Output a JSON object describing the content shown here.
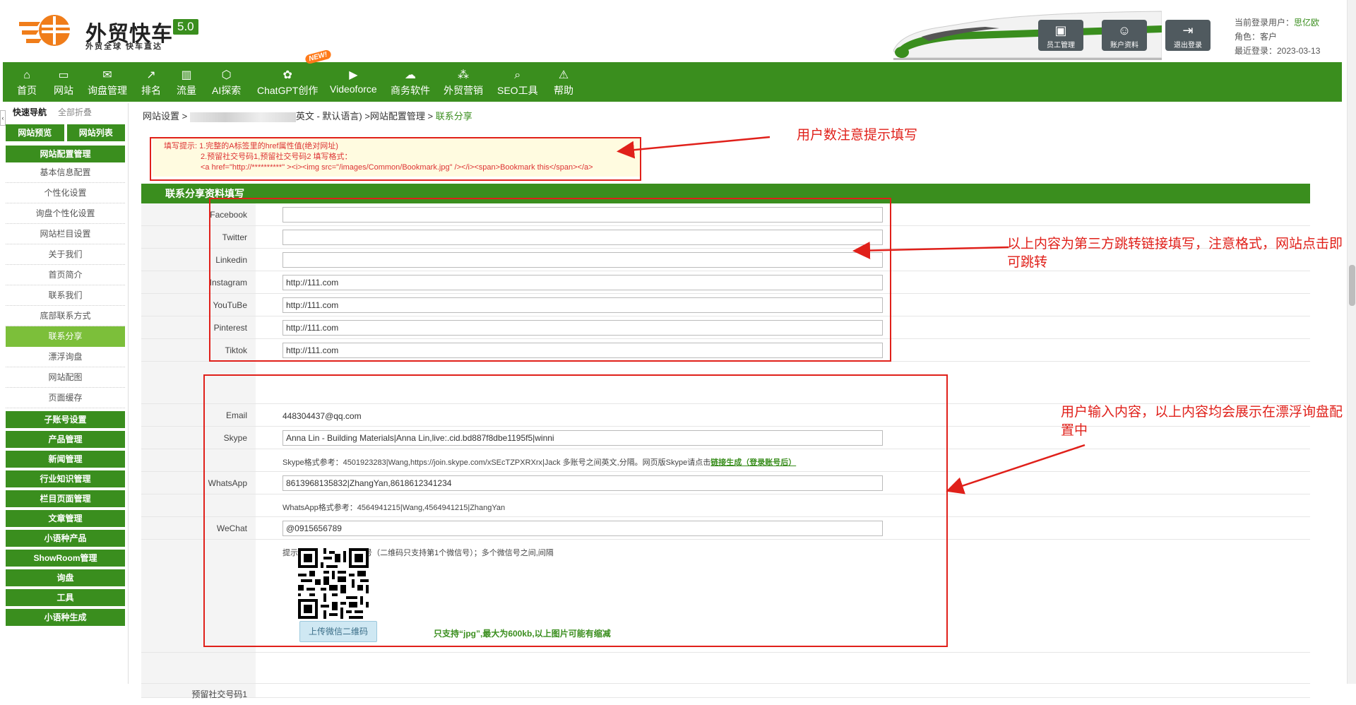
{
  "header": {
    "logo_title": "外贸快车",
    "logo_version": "5.0",
    "logo_slogan": "外贸全球 快车直达",
    "buttons": [
      {
        "label": "员工管理",
        "icon": "staff-icon"
      },
      {
        "label": "账户资料",
        "icon": "account-icon"
      },
      {
        "label": "退出登录",
        "icon": "logout-icon"
      }
    ],
    "user": {
      "current_user_label": "当前登录用户：",
      "current_user": "思亿欧",
      "role": "角色：客户",
      "last_login": "最近登录：2023-03-13"
    }
  },
  "nav": {
    "new_badge": "NEW!",
    "items": [
      {
        "label": "首页",
        "icon": "home-icon"
      },
      {
        "label": "网站",
        "icon": "monitor-icon"
      },
      {
        "label": "询盘管理",
        "icon": "mail-icon"
      },
      {
        "label": "排名",
        "icon": "rank-icon"
      },
      {
        "label": "流量",
        "icon": "chart-icon"
      },
      {
        "label": "AI探索",
        "icon": "ai-icon"
      },
      {
        "label": "ChatGPT创作",
        "icon": "chatgpt-icon"
      },
      {
        "label": "Videoforce",
        "icon": "video-icon"
      },
      {
        "label": "商务软件",
        "icon": "software-icon"
      },
      {
        "label": "外贸营销",
        "icon": "marketing-icon"
      },
      {
        "label": "SEO工具",
        "icon": "search-icon"
      },
      {
        "label": "帮助",
        "icon": "help-icon"
      }
    ]
  },
  "sidebar": {
    "tab_quick": "快速导航",
    "tab_collapse": "全部折叠",
    "preview": "网站预览",
    "site_list": "网站列表",
    "group_title": "网站配置管理",
    "sub_items": [
      "基本信息配置",
      "个性化设置",
      "询盘个性化设置",
      "网站栏目设置",
      "关于我们",
      "首页简介",
      "联系我们",
      "底部联系方式",
      "联系分享",
      "漂浮询盘",
      "网站配图",
      "页面缓存"
    ],
    "categories": [
      "子账号设置",
      "产品管理",
      "新闻管理",
      "行业知识管理",
      "栏目页面管理",
      "文章管理",
      "小语种产品",
      "ShowRoom管理",
      "询盘",
      "工具",
      "小语种生成"
    ]
  },
  "main": {
    "breadcrumb_1": "网站设置 >",
    "breadcrumb_2": "英文 - 默认语言) >网站配置管理 >",
    "breadcrumb_current": "联系分享",
    "tip_line1": "填写提示: 1.完整的A标签里的href属性值(绝对网址)",
    "tip_line2": "2.预留社交号码1,预留社交号码2 填写格式：",
    "tip_line3": "<a href=\"http://**********\" ><i><img src=\"/images/Common/Bookmark.jpg\" /></i><span>Bookmark this</span></a>",
    "section_title": "联系分享资料填写",
    "social": [
      {
        "label": "Facebook",
        "value": ""
      },
      {
        "label": "Twitter",
        "value": ""
      },
      {
        "label": "Linkedin",
        "value": ""
      },
      {
        "label": "Instagram",
        "value": "http://111.com"
      },
      {
        "label": "YouTuBe",
        "value": "http://111.com"
      },
      {
        "label": "Pinterest",
        "value": "http://111.com"
      },
      {
        "label": "Tiktok",
        "value": "http://111.com"
      }
    ],
    "email_label": "Email",
    "email_value": "448304437@qq.com",
    "skype_label": "Skype",
    "skype_value": "Anna Lin - Building Materials|Anna Lin,live:.cid.bd887f8dbe1195f5|winni",
    "skype_hint": "Skype格式参考：4501923283|Wang,https://join.skype.com/xSEcTZPXRXrx|Jack 多账号之间英文,分隔。网页版Skype请点击",
    "skype_hint_link": "链接生成（登录账号后）",
    "whatsapp_label": "WhatsApp",
    "whatsapp_value": "8613968135832|ZhangYan,8618612341234",
    "whatsapp_hint": "WhatsApp格式参考：4564941215|Wang,4564941215|ZhangYan",
    "wechat_label": "WeChat",
    "wechat_value": "@0915656789",
    "wechat_hint": "提示：建议填写1个微信号（二维码只支持第1个微信号）；多个微信号之间,间隔",
    "upload_label": "上传微信二维码",
    "upload_note": "只支持“jpg”,最大为600kb,以上图片可能有缩减",
    "reserved_label": "预留社交号码1"
  },
  "annotations": {
    "tip_note": "用户数注意提示填写",
    "social_note": "以上内容为第三方跳转链接填写，注意格式，网站点击即可跳转",
    "contact_note": "用户输入内容，以上内容均会展示在漂浮询盘配置中",
    "color": "#e0201a"
  },
  "colors": {
    "brand_green": "#3a8e1e",
    "active_green": "#7cbf3a",
    "logo_orange": "#f07d1a"
  }
}
